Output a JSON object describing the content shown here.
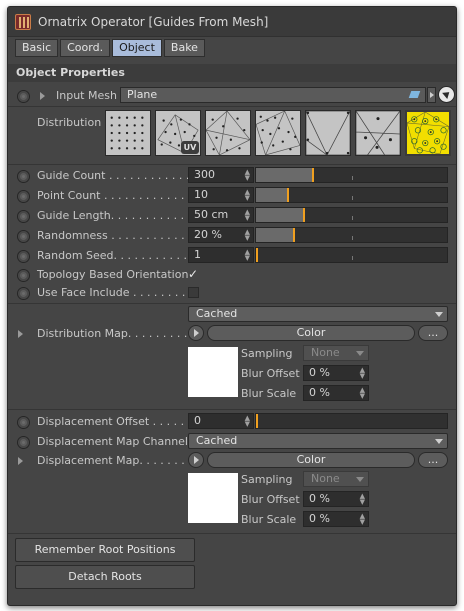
{
  "window": {
    "title": "Ornatrix Operator [Guides From Mesh]"
  },
  "tabs": [
    {
      "label": "Basic",
      "active": false
    },
    {
      "label": "Coord.",
      "active": false
    },
    {
      "label": "Object",
      "active": true
    },
    {
      "label": "Bake",
      "active": false
    }
  ],
  "section": {
    "title": "Object Properties"
  },
  "input_mesh": {
    "label": "Input Mesh",
    "value": "Plane",
    "link_icon": "link-diamond-icon",
    "pick_icon": "pick-object-icon"
  },
  "distribution": {
    "label": "Distribution",
    "selected_index": 7,
    "thumb_icons": [
      "grid-distribution-icon",
      "uv-distribution-icon",
      "random-face-icon",
      "even-distribution-icon",
      "vertex-distribution-icon",
      "face-center-icon",
      "face-edge-icon",
      "per-vertex-icon"
    ],
    "uv_badge": "UV"
  },
  "params": {
    "guide_count": {
      "label": "Guide Count . . . . . . . . . . . . . .",
      "value": "300",
      "slider_fraction": 0.3
    },
    "point_count": {
      "label": "Point Count . . . . . . . . . . . . . .",
      "value": "10",
      "slider_fraction": 0.17
    },
    "guide_length": {
      "label": "Guide Length. . . . . . . . . . . . .",
      "value": "50 cm",
      "slider_fraction": 0.25
    },
    "randomness": {
      "label": "Randomness . . . . . . . . . . . . .",
      "value": "20 %",
      "slider_fraction": 0.2
    },
    "random_seed": {
      "label": "Random Seed. . . . . . . . . . . . .",
      "value": "1",
      "slider_fraction": 0.0
    }
  },
  "topology": {
    "label": "Topology Based Orientation",
    "checked": true,
    "check_glyph": "✓"
  },
  "face_include": {
    "label": "Use Face Include . . . . . . . . . .",
    "checked": false
  },
  "distribution_map": {
    "label": "Distribution Map. . . . . . . . . .",
    "mode": "Cached",
    "color_button": "Color",
    "more_button": "...",
    "sampling_label": "Sampling",
    "sampling_value": "None",
    "blur_offset_label": "Blur Offset",
    "blur_offset_value": "0 %",
    "blur_scale_label": "Blur Scale",
    "blur_scale_value": "0 %"
  },
  "displacement_offset": {
    "label": "Displacement Offset . . . . . .",
    "value": "0",
    "slider_fraction": 0.0
  },
  "displacement_channel": {
    "label": "Displacement Map Channel",
    "value": "Cached"
  },
  "displacement_map": {
    "label": "Displacement Map. . . . . . . . .",
    "color_button": "Color",
    "more_button": "...",
    "sampling_label": "Sampling",
    "sampling_value": "None",
    "blur_offset_label": "Blur Offset",
    "blur_offset_value": "0 %",
    "blur_scale_label": "Blur Scale",
    "blur_scale_value": "0 %"
  },
  "buttons": {
    "remember_root": "Remember Root Positions",
    "detach_roots": "Detach Roots"
  },
  "colors": {
    "accent": "#f0a020",
    "active_tab": "#a9bcdb",
    "selected_thumb": "#f2de00"
  }
}
